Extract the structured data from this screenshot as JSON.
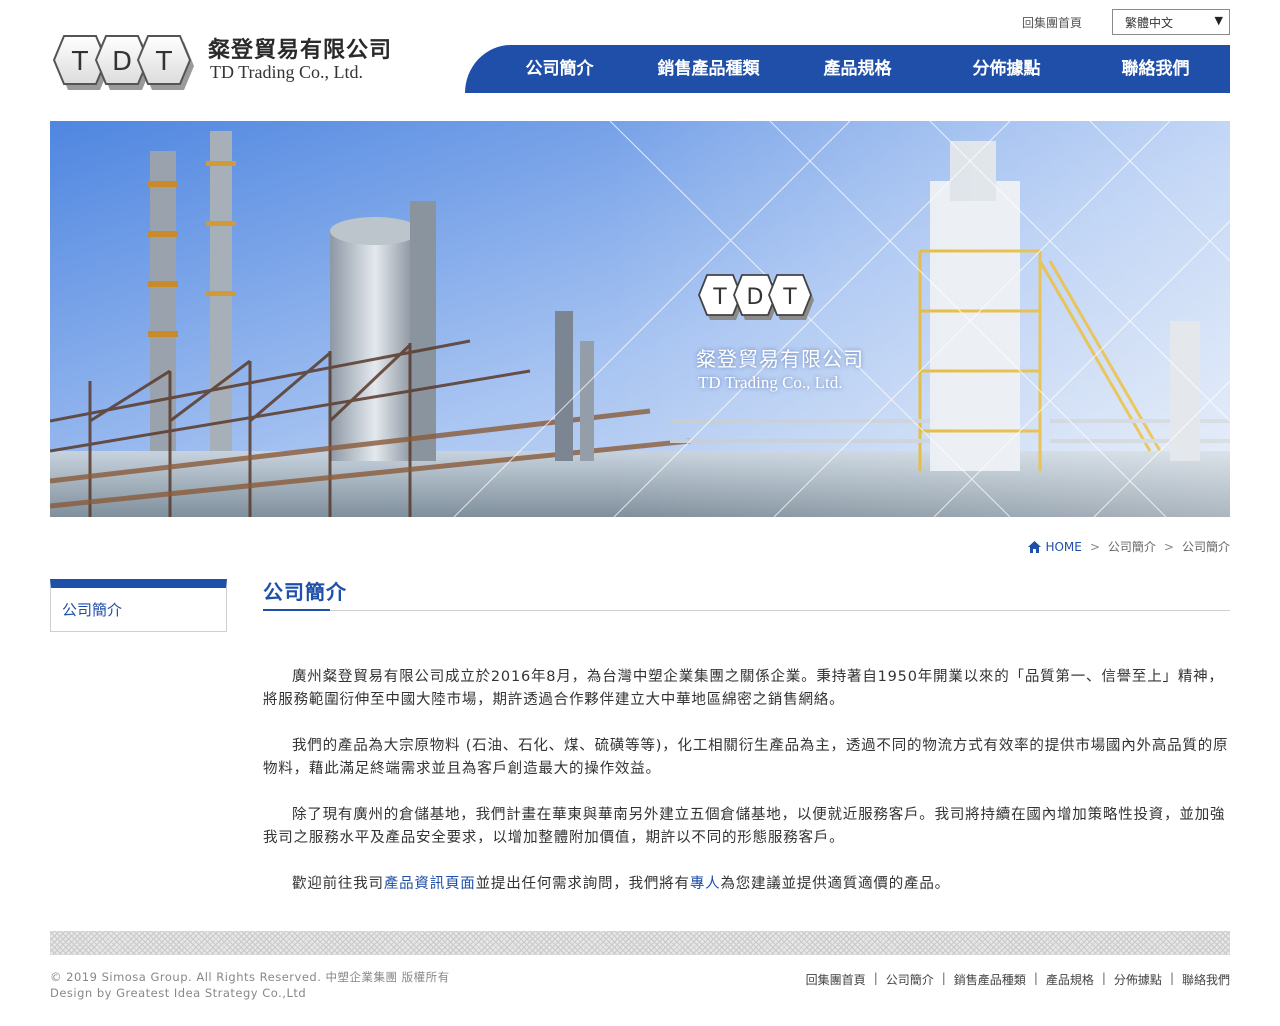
{
  "header": {
    "logo_text": "TDT",
    "company_cn": "粲登貿易有限公司",
    "company_en": "TD Trading Co., Ltd.",
    "group_home": "回集團首頁",
    "language": "繁體中文"
  },
  "nav": [
    {
      "label": "公司簡介"
    },
    {
      "label": "銷售產品種類"
    },
    {
      "label": "產品規格"
    },
    {
      "label": "分佈據點"
    },
    {
      "label": "聯絡我們"
    }
  ],
  "banner": {
    "logo_text": "TDT",
    "company_cn": "粲登貿易有限公司",
    "company_en": "TD Trading Co., Ltd."
  },
  "breadcrumb": {
    "home": "HOME",
    "level1": "公司簡介",
    "level2": "公司簡介",
    "separator": ">"
  },
  "sidebar": {
    "items": [
      {
        "label": "公司簡介"
      }
    ]
  },
  "main": {
    "title": "公司簡介",
    "paragraphs": [
      "廣州粲登貿易有限公司成立於2016年8月，為台灣中塑企業集團之關係企業。秉持著自1950年開業以來的「品質第一、信譽至上」精神，將服務範圍衍伸至中國大陸市場，期許透過合作夥伴建立大中華地區綿密之銷售網絡。",
      "我們的產品為大宗原物料 (石油、石化、煤、硫磺等等)，化工相關衍生產品為主，透過不同的物流方式有效率的提供市場國內外高品質的原物料，藉此滿足終端需求並且為客戶創造最大的操作效益。",
      "除了現有廣州的倉儲基地，我們計畫在華東與華南另外建立五個倉儲基地，以便就近服務客戶。我司將持續在國內增加策略性投資，並加強我司之服務水平及產品安全要求，以增加整體附加價值，期許以不同的形態服務客戶。"
    ],
    "last_paragraph": {
      "part1": "歡迎前往我司",
      "link1": "產品資訊頁面",
      "part2": "並提出任何需求詢問，我們將有",
      "link2": "專人",
      "part3": "為您建議並提供適質適價的產品。"
    }
  },
  "footer": {
    "copyright_line1": "© 2019 Simosa Group. All Rights Reserved. 中塑企業集團 版權所有",
    "copyright_line2": "Design by Greatest Idea Strategy Co.,Ltd",
    "links": [
      {
        "label": "回集團首頁"
      },
      {
        "label": "公司簡介"
      },
      {
        "label": "銷售產品種類"
      },
      {
        "label": "產品規格"
      },
      {
        "label": "分佈據點"
      },
      {
        "label": "聯絡我們"
      }
    ],
    "link_separator": "|"
  },
  "colors": {
    "brand_blue": "#1f4fa8",
    "text": "#333333",
    "footer_text": "#888888"
  }
}
